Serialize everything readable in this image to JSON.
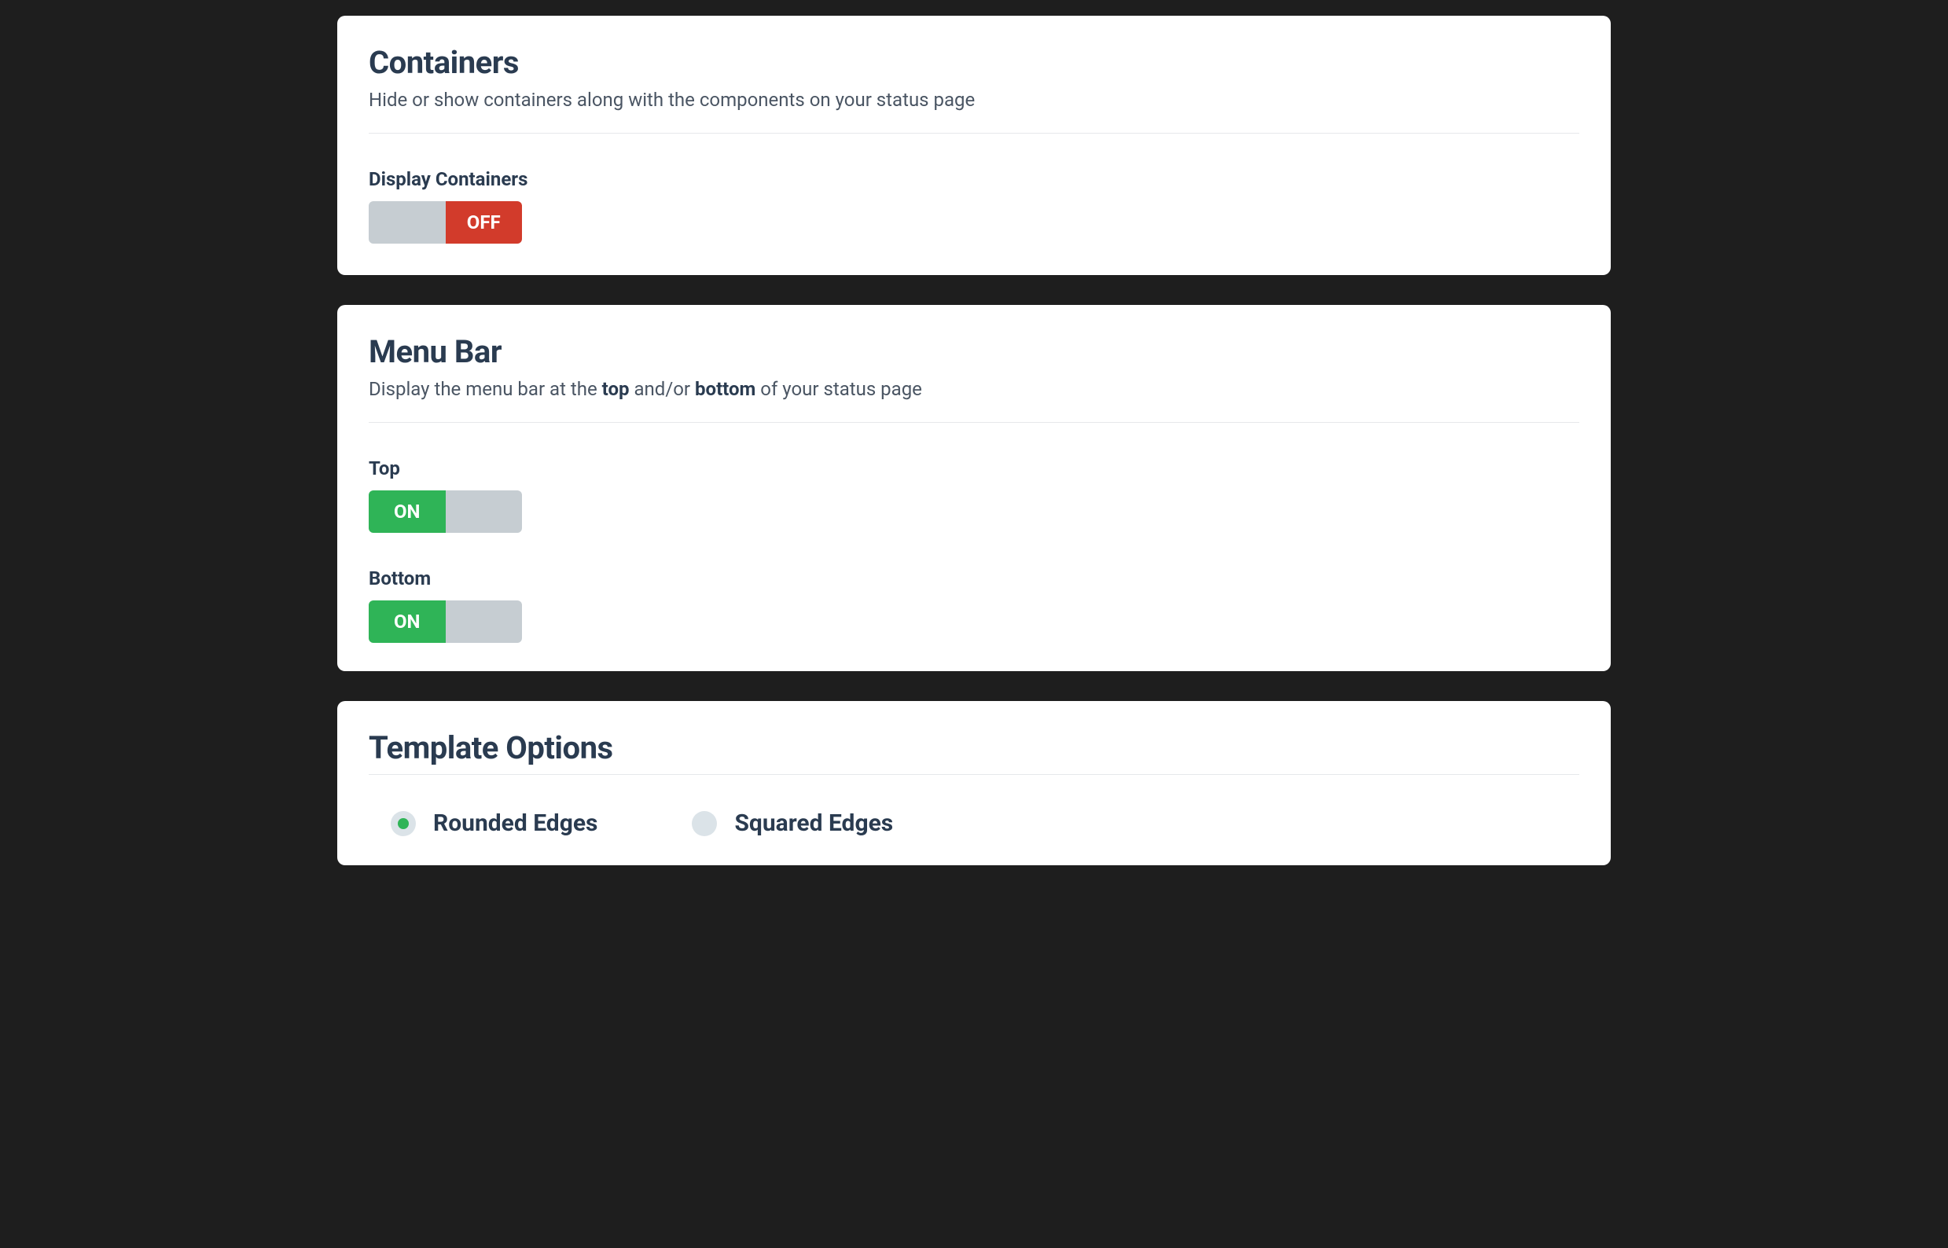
{
  "containers": {
    "title": "Containers",
    "description": "Hide or show containers along with the components on your status page",
    "display_label": "Display Containers",
    "toggle_state": "off",
    "toggle_off_label": "OFF"
  },
  "menubar": {
    "title": "Menu Bar",
    "description_prefix": "Display the menu bar at the ",
    "description_top": "top",
    "description_mid": " and/or ",
    "description_bottom": "bottom",
    "description_suffix": " of your status page",
    "top": {
      "label": "Top",
      "toggle_state": "on",
      "toggle_on_label": "ON"
    },
    "bottom": {
      "label": "Bottom",
      "toggle_state": "on",
      "toggle_on_label": "ON"
    }
  },
  "template": {
    "title": "Template Options",
    "options": {
      "rounded": {
        "label": "Rounded Edges",
        "selected": true
      },
      "squared": {
        "label": "Squared Edges",
        "selected": false
      }
    }
  }
}
